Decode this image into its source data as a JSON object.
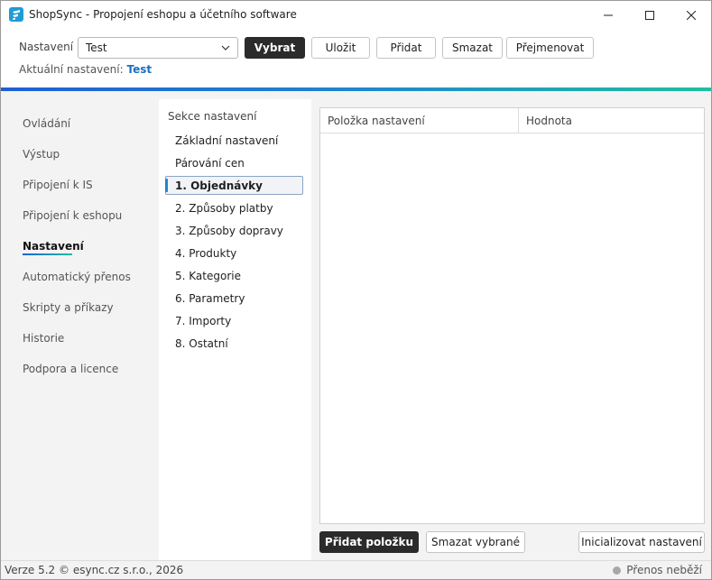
{
  "window": {
    "title": "ShopSync - Propojení eshopu a účetního software"
  },
  "toolbar": {
    "settings_label": "Nastavení",
    "settings_value": "Test",
    "buttons": {
      "select": "Vybrat",
      "save": "Uložit",
      "add": "Přidat",
      "delete": "Smazat",
      "rename": "Přejmenovat"
    },
    "current_label": "Aktuální nastavení:",
    "current_value": "Test"
  },
  "nav": {
    "items": [
      {
        "label": "Ovládání"
      },
      {
        "label": "Výstup"
      },
      {
        "label": "Připojení k IS"
      },
      {
        "label": "Připojení k eshopu"
      },
      {
        "label": "Nastavení",
        "active": true
      },
      {
        "label": "Automatický přenos"
      },
      {
        "label": "Skripty a příkazy"
      },
      {
        "label": "Historie"
      },
      {
        "label": "Podpora a licence"
      }
    ]
  },
  "sections": {
    "title": "Sekce nastavení",
    "items": [
      {
        "label": "Základní nastavení"
      },
      {
        "label": "Párování cen"
      },
      {
        "label": "1. Objednávky",
        "selected": true
      },
      {
        "label": "2. Způsoby platby"
      },
      {
        "label": "3. Způsoby dopravy"
      },
      {
        "label": "4. Produkty"
      },
      {
        "label": "5. Kategorie"
      },
      {
        "label": "6. Parametry"
      },
      {
        "label": "7. Importy"
      },
      {
        "label": "8. Ostatní"
      }
    ]
  },
  "table": {
    "columns": [
      "Položka nastavení",
      "Hodnota"
    ],
    "rows": []
  },
  "actions": {
    "add_item": "Přidat položku",
    "delete_selected": "Smazat vybrané",
    "initialize": "Inicializovat nastavení"
  },
  "status": {
    "version": "Verze 5.2",
    "copyright": "© esync.cz s.r.o., 2026",
    "transfer_state": "Přenos neběží"
  },
  "colors": {
    "accent_blue": "#1a6fc0",
    "gradient_start": "#1f5fd6",
    "gradient_end": "#1fbf9e",
    "dark_button": "#2b2b2b"
  }
}
